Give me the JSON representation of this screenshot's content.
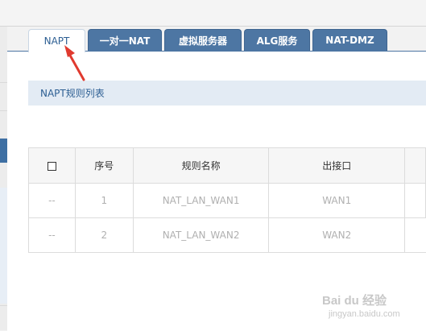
{
  "tabs": [
    {
      "label": "NAPT",
      "active": true
    },
    {
      "label": "一对一NAT",
      "active": false
    },
    {
      "label": "虚拟服务器",
      "active": false
    },
    {
      "label": "ALG服务",
      "active": false
    },
    {
      "label": "NAT-DMZ",
      "active": false
    }
  ],
  "banner": {
    "title": "NAPT规则列表"
  },
  "table": {
    "headers": [
      "序号",
      "规则名称",
      "出接口"
    ],
    "rows": [
      {
        "check": "--",
        "index": "1",
        "name": "NAT_LAN_WAN1",
        "interface": "WAN1"
      },
      {
        "check": "--",
        "index": "2",
        "name": "NAT_LAN_WAN2",
        "interface": "WAN2"
      }
    ]
  },
  "watermark": {
    "brand": "Bai du 经验",
    "url": "jingyan.baidu.com"
  },
  "colors": {
    "accent": "#4d76a3",
    "annotation_arrow": "#e03a2f"
  }
}
